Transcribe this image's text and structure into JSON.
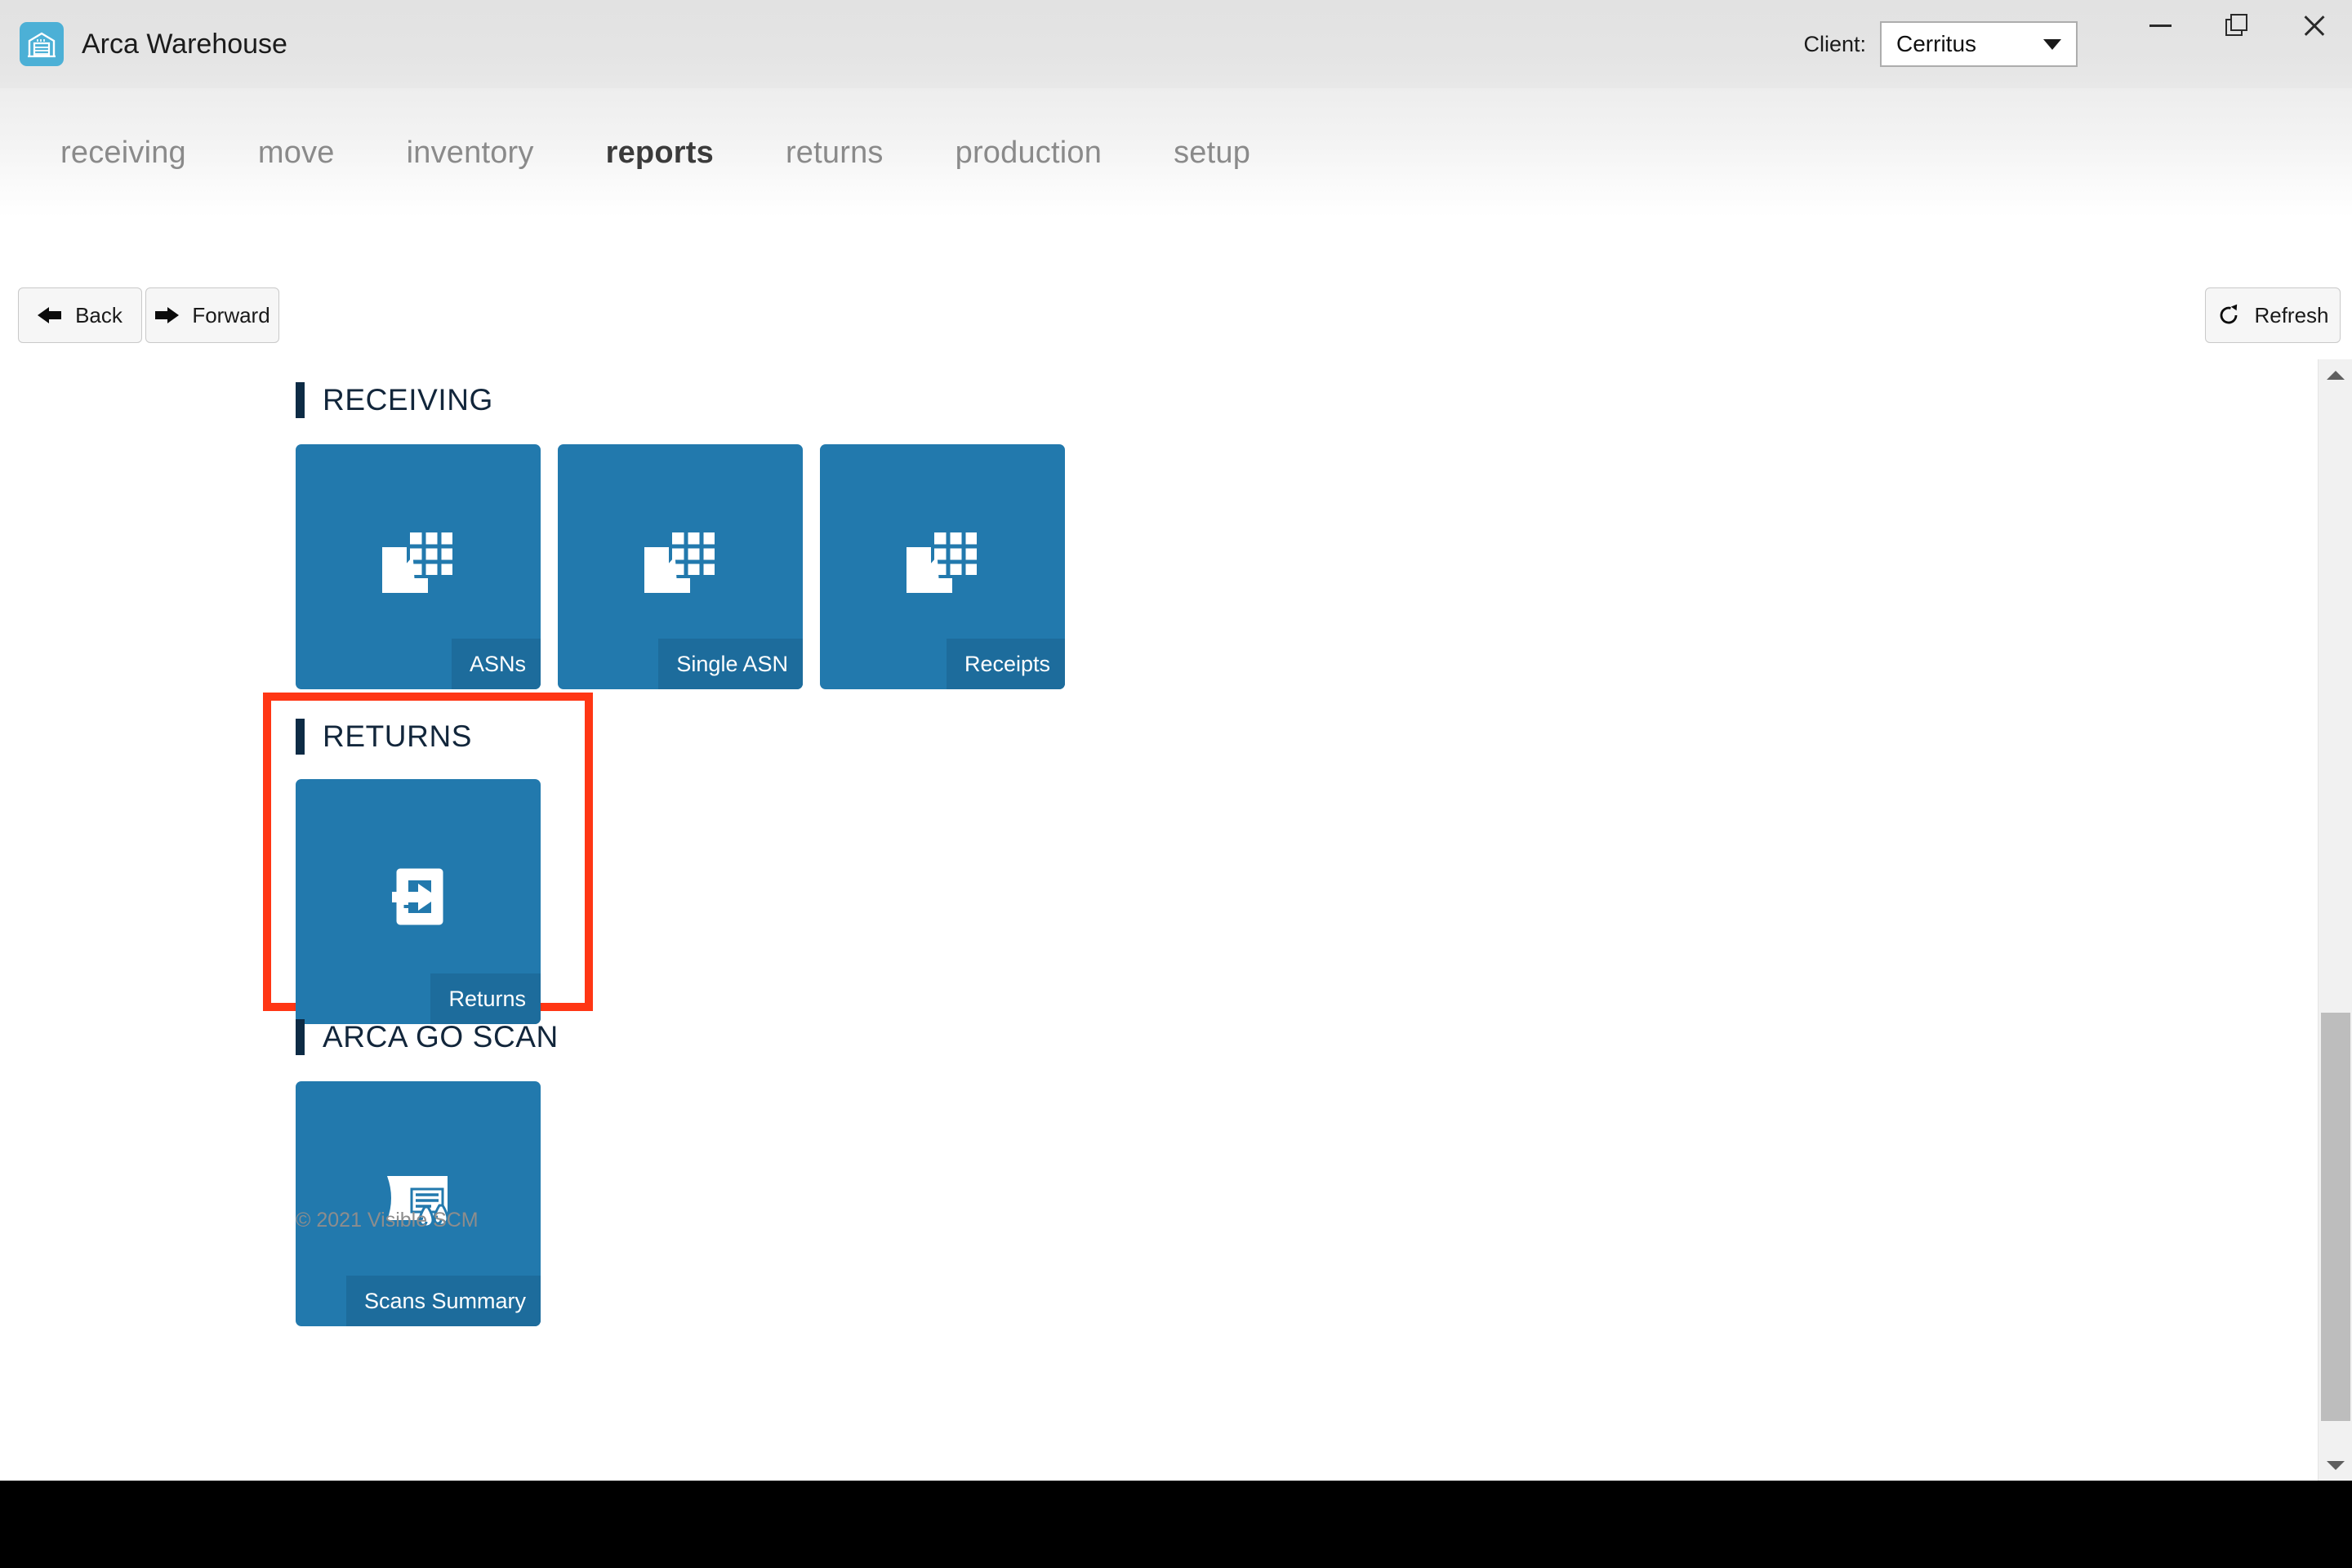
{
  "window": {
    "app_icon": "warehouse-icon",
    "title": "Arca Warehouse",
    "client_label": "Client:",
    "client_value": "Cerritus",
    "minimize_icon": "minimize-icon",
    "maximize_icon": "maximize-icon",
    "close_icon": "close-icon"
  },
  "nav": {
    "items": [
      {
        "label": "receiving",
        "active": false
      },
      {
        "label": "move",
        "active": false
      },
      {
        "label": "inventory",
        "active": false
      },
      {
        "label": "reports",
        "active": true
      },
      {
        "label": "returns",
        "active": false
      },
      {
        "label": "production",
        "active": false
      },
      {
        "label": "setup",
        "active": false
      }
    ]
  },
  "toolbar": {
    "back_label": "Back",
    "back_icon": "arrow-left-icon",
    "forward_label": "Forward",
    "forward_icon": "arrow-right-icon",
    "refresh_label": "Refresh",
    "refresh_icon": "refresh-icon"
  },
  "sections": {
    "receiving": {
      "title": "RECEIVING",
      "tiles": [
        {
          "label": "ASNs",
          "icon": "grid-arrow-icon"
        },
        {
          "label": "Single ASN",
          "icon": "grid-arrow-icon"
        },
        {
          "label": "Receipts",
          "icon": "grid-arrow-icon"
        }
      ]
    },
    "returns": {
      "title": "RETURNS",
      "highlighted": true,
      "tiles": [
        {
          "label": "Returns",
          "icon": "arrow-into-box-icon"
        }
      ]
    },
    "arca_go_scan": {
      "title": "ARCA GO SCAN",
      "tiles": [
        {
          "label": "Scans Summary",
          "icon": "document-inspect-icon"
        }
      ]
    }
  },
  "footer": {
    "copyright": "© 2021 Visible SCM"
  },
  "colors": {
    "tile_blue": "#2279AD",
    "tile_label_blue": "#1D6C9C",
    "section_accent": "#0D2B45",
    "highlight_red": "#FF3614",
    "app_icon_blue": "#4CB0D6"
  }
}
